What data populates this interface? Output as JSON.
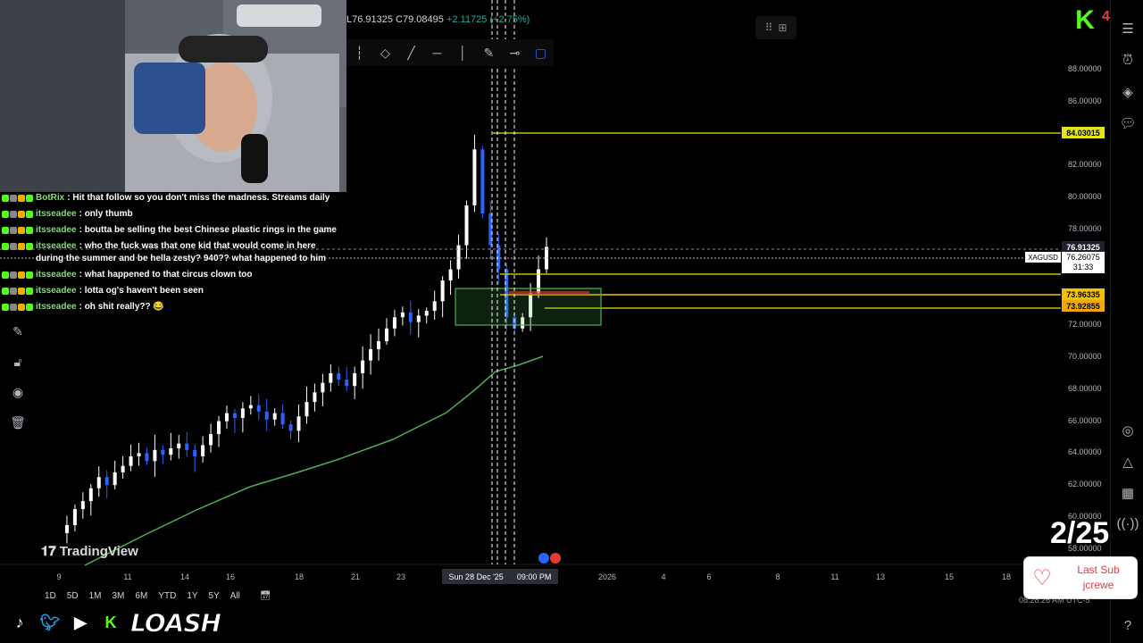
{
  "ohlc": {
    "text": "L76.91325 C79.08495 ",
    "change": "+2.11725 (+2.75%)"
  },
  "toolbar": {
    "tools": [
      "cursor-tool",
      "ellipse-tool",
      "trend-line-tool",
      "horizontal-line-tool",
      "vertical-line-tool",
      "brush-tool",
      "horizontal-ray-tool",
      "rectangle-tool"
    ]
  },
  "fullscreen_icon": "grid-plus-icon",
  "chat": [
    {
      "user": "BotRix",
      "text": ": Hit that follow so you don't miss the madness. Streams daily"
    },
    {
      "user": "itsseadee",
      "text": ": only thumb"
    },
    {
      "user": "itsseadee",
      "text": ": boutta be selling the best Chinese plastic rings in the game"
    },
    {
      "user": "itsseadee",
      "text": ": who the fuck was that one kid that would come in here during the summer and be hella zesty? 940?? what happened to him"
    },
    {
      "user": "itsseadee",
      "text": ": what happened to that circus clown too"
    },
    {
      "user": "itsseadee",
      "text": ": lotta og's haven't been seen"
    },
    {
      "user": "itsseadee",
      "text": ": oh shit really?? 😂"
    }
  ],
  "price_axis": [
    "88.00000",
    "86.00000",
    "82.00000",
    "80.00000",
    "78.00000",
    "72.00000",
    "70.00000",
    "68.00000",
    "66.00000",
    "64.00000",
    "62.00000",
    "60.00000",
    "58.00000"
  ],
  "tags": {
    "top_level": "84.03015",
    "last_price": "76.91325",
    "symbol": "XAGUSD",
    "symbol_price": "76.26075",
    "countdown": "31:33",
    "level_a": "73.96335",
    "level_b": "73.92855"
  },
  "time_axis": [
    "9",
    "11",
    "14",
    "16",
    "18",
    "21",
    "23",
    "2026",
    "4",
    "6",
    "8",
    "11",
    "13",
    "15",
    "18"
  ],
  "crosshair_time": {
    "date": "Sun 28 Dec '25",
    "time": "09:00 PM"
  },
  "ranges": [
    "1D",
    "5D",
    "1M",
    "3M",
    "6M",
    "YTD",
    "1Y",
    "5Y",
    "All"
  ],
  "timezone": "08:28:26 AM UTC-5",
  "brand": "TradingView",
  "overlay": {
    "streamer": "LOASH",
    "counter": "2/25",
    "kick_count": "4",
    "last_sub_label": "Last Sub",
    "last_sub_name": "jcrewe"
  },
  "colors": {
    "up": "#ffffff",
    "down": "#2962ff",
    "level": "#e3e319",
    "ma": "#4caf50",
    "zone": "#4caf50",
    "accent": "#2962ff"
  },
  "chart_data": {
    "type": "candlestick",
    "symbol": "XAGUSD",
    "moving_average": [
      59.0,
      60.0,
      61.0,
      62.0,
      63.0,
      63.6,
      64.2,
      65.3,
      66.8,
      68.6,
      70.0,
      70.0
    ],
    "levels": [
      84.03015,
      76.91325,
      76.26075,
      73.96335,
      73.92855
    ]
  }
}
